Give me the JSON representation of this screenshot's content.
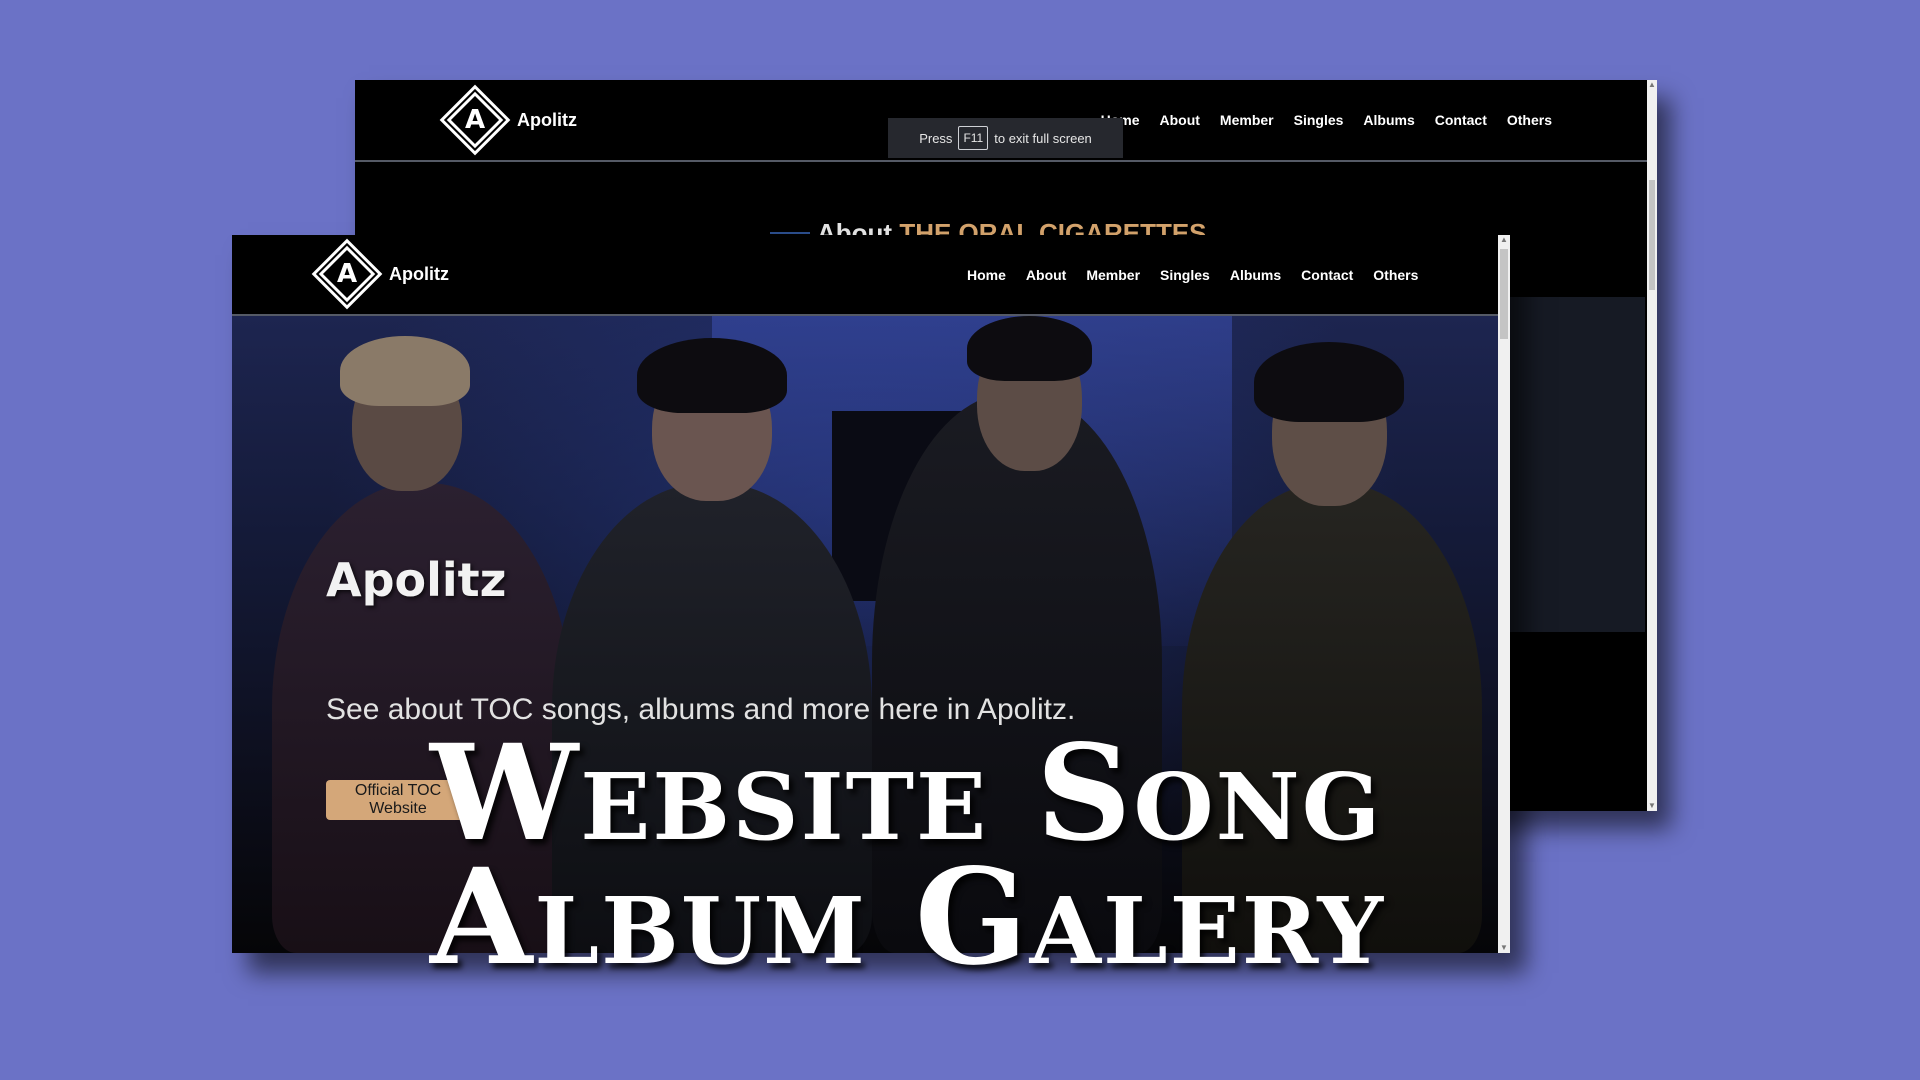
{
  "back_window": {
    "brand": {
      "logo_letter": "A",
      "name": "Apolitz"
    },
    "nav": [
      "Home",
      "About",
      "Member",
      "Singles",
      "Albums",
      "Contact",
      "Others"
    ],
    "fullscreen_notice": {
      "press": "Press",
      "key": "F11",
      "suffix": "to exit full screen"
    },
    "about_heading": {
      "prefix": "About ",
      "accent": "THE ORAL CIGARETTES"
    }
  },
  "front_window": {
    "brand": {
      "logo_letter": "A",
      "name": "Apolitz"
    },
    "nav": [
      "Home",
      "About",
      "Member",
      "Singles",
      "Albums",
      "Contact",
      "Others"
    ],
    "hero": {
      "title": "Apolitz",
      "subtitle": "See about TOC songs, albums and more here in Apolitz.",
      "button": "Official TOC Website"
    }
  },
  "overlay": {
    "line1": "Website Song",
    "line2": "Album Galery"
  },
  "colors": {
    "background": "#6b72c6",
    "accent": "#d4a36c",
    "button": "#d4a779",
    "window": "#000000"
  }
}
